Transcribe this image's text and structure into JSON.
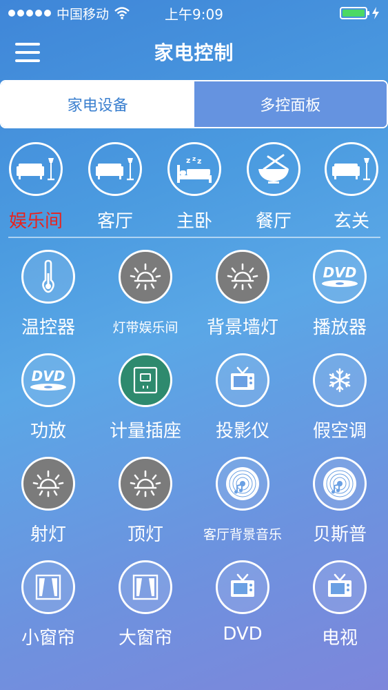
{
  "status": {
    "carrier": "中国移动",
    "time": "上午9:09",
    "battery_color": "#4cd964"
  },
  "nav": {
    "title": "家电控制"
  },
  "tabs": [
    {
      "label": "家电设备",
      "active": true
    },
    {
      "label": "多控面板",
      "active": false
    }
  ],
  "rooms": [
    {
      "label": "娱乐间",
      "icon": "sofa-icon",
      "active": true,
      "active_color": "#e8231e"
    },
    {
      "label": "客厅",
      "icon": "sofa-icon",
      "active": false
    },
    {
      "label": "主卧",
      "icon": "bed-icon",
      "active": false
    },
    {
      "label": "餐厅",
      "icon": "dining-icon",
      "active": false
    },
    {
      "label": "玄关",
      "icon": "sofa-icon",
      "active": false
    }
  ],
  "devices": [
    {
      "label": "温控器",
      "icon": "thermometer-icon"
    },
    {
      "label": "灯带娱乐间",
      "icon": "light-icon"
    },
    {
      "label": "背景墙灯",
      "icon": "light-icon"
    },
    {
      "label": "播放器",
      "icon": "dvd-icon",
      "icon_text": "DVD"
    },
    {
      "label": "功放",
      "icon": "dvd-icon",
      "icon_text": "DVD"
    },
    {
      "label": "计量插座",
      "icon": "socket-icon"
    },
    {
      "label": "投影仪",
      "icon": "tv-icon"
    },
    {
      "label": "假空调",
      "icon": "snowflake-icon"
    },
    {
      "label": "射灯",
      "icon": "light-icon"
    },
    {
      "label": "顶灯",
      "icon": "light-icon"
    },
    {
      "label": "客厅背景音乐",
      "icon": "music-disc-icon"
    },
    {
      "label": "贝斯普",
      "icon": "music-disc-icon"
    },
    {
      "label": "小窗帘",
      "icon": "curtain-icon"
    },
    {
      "label": "大窗帘",
      "icon": "curtain-icon"
    },
    {
      "label": "DVD",
      "icon": "tv-icon"
    },
    {
      "label": "电视",
      "icon": "tv-icon"
    }
  ]
}
